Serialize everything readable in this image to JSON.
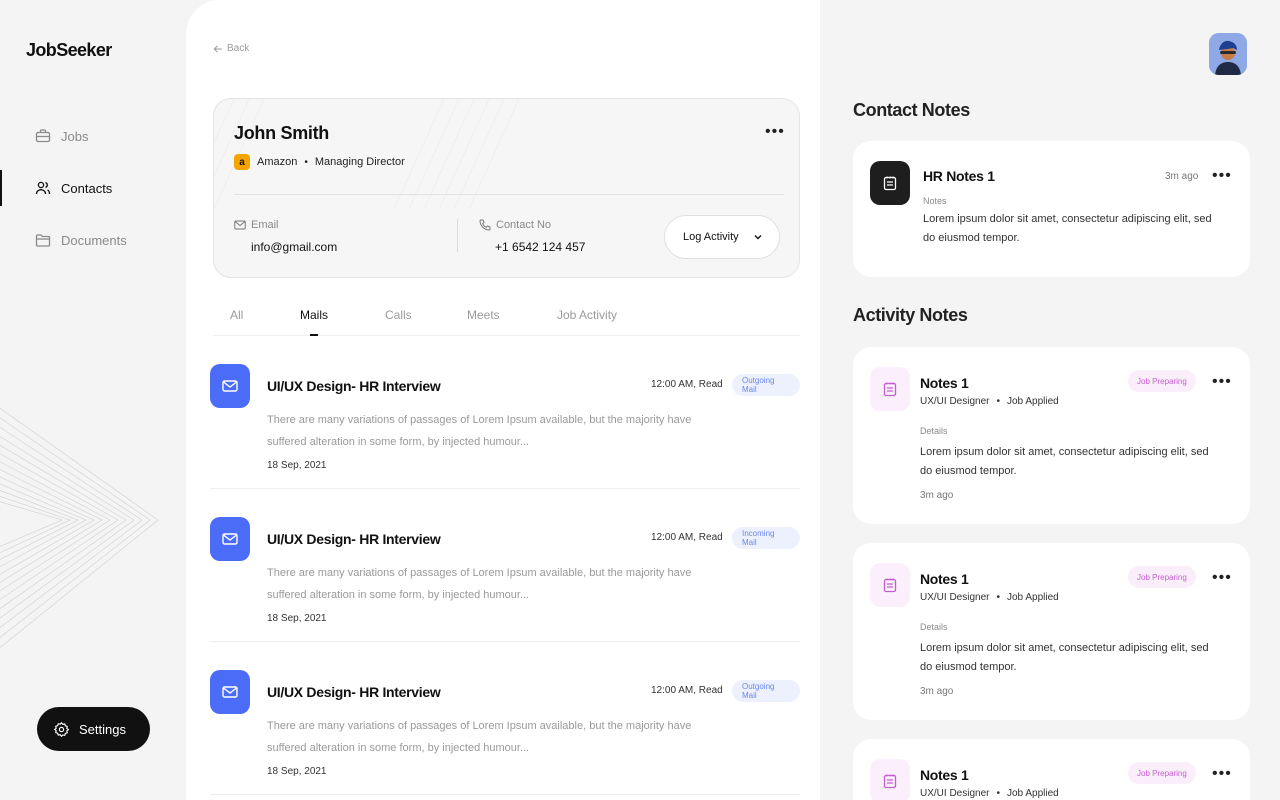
{
  "app": {
    "logo": "JobSeeker"
  },
  "sidebar": {
    "items": [
      {
        "label": "Jobs",
        "icon": "briefcase-icon"
      },
      {
        "label": "Contacts",
        "icon": "users-icon"
      },
      {
        "label": "Documents",
        "icon": "folder-icon"
      }
    ],
    "settings_label": "Settings"
  },
  "header": {
    "back_label": "Back"
  },
  "contact": {
    "name": "John Smith",
    "company_logo": "a",
    "company": "Amazon",
    "role": "Managing Director",
    "email_label": "Email",
    "email": "info@gmail.com",
    "phone_label": "Contact No",
    "phone": "+1 6542 124 457",
    "log_activity_label": "Log Activity"
  },
  "tabs": [
    {
      "label": "All"
    },
    {
      "label": "Mails"
    },
    {
      "label": "Calls"
    },
    {
      "label": "Meets"
    },
    {
      "label": "Job Activity"
    }
  ],
  "mails": [
    {
      "title": "UI/UX Design- HR Interview",
      "time": "12:00 AM, Read",
      "badge": "Outgoing Mail",
      "body": "There are many variations of passages of Lorem Ipsum available, but the majority have suffered alteration in some form, by injected humour...",
      "date": "18 Sep, 2021"
    },
    {
      "title": "UI/UX Design- HR Interview",
      "time": "12:00 AM, Read",
      "badge": "Incoming Mail",
      "body": "There are many variations of passages of Lorem Ipsum available, but the majority have suffered alteration in some form, by injected humour...",
      "date": "18 Sep, 2021"
    },
    {
      "title": "UI/UX Design- HR Interview",
      "time": "12:00 AM, Read",
      "badge": "Outgoing Mail",
      "body": "There are many variations of passages of Lorem Ipsum available, but the majority have suffered alteration in some form, by injected humour...",
      "date": "18 Sep, 2021"
    }
  ],
  "contact_notes": {
    "title": "Contact Notes",
    "items": [
      {
        "title": "HR Notes 1",
        "time": "3m ago",
        "label": "Notes",
        "text": "Lorem ipsum dolor sit amet, consectetur adipiscing elit, sed do eiusmod tempor."
      }
    ]
  },
  "activity_notes": {
    "title": "Activity Notes",
    "items": [
      {
        "title": "Notes 1",
        "role": "UX/UI Designer",
        "status": "Job Applied",
        "badge": "Job Preparing",
        "details_label": "Details",
        "text": "Lorem ipsum dolor sit amet, consectetur adipiscing elit, sed do eiusmod tempor.",
        "time": "3m ago"
      },
      {
        "title": "Notes 1",
        "role": "UX/UI Designer",
        "status": "Job Applied",
        "badge": "Job Preparing",
        "details_label": "Details",
        "text": "Lorem ipsum dolor sit amet, consectetur adipiscing elit, sed do eiusmod tempor.",
        "time": "3m ago"
      },
      {
        "title": "Notes 1",
        "role": "UX/UI Designer",
        "status": "Job Applied",
        "badge": "Job Preparing"
      }
    ]
  },
  "colors": {
    "accent_blue": "#4a6cf7",
    "badge_blue_bg": "#edf1fd",
    "badge_pink_bg": "#fbeefb",
    "badge_pink_text": "#c45fd0",
    "dark": "#111111"
  }
}
